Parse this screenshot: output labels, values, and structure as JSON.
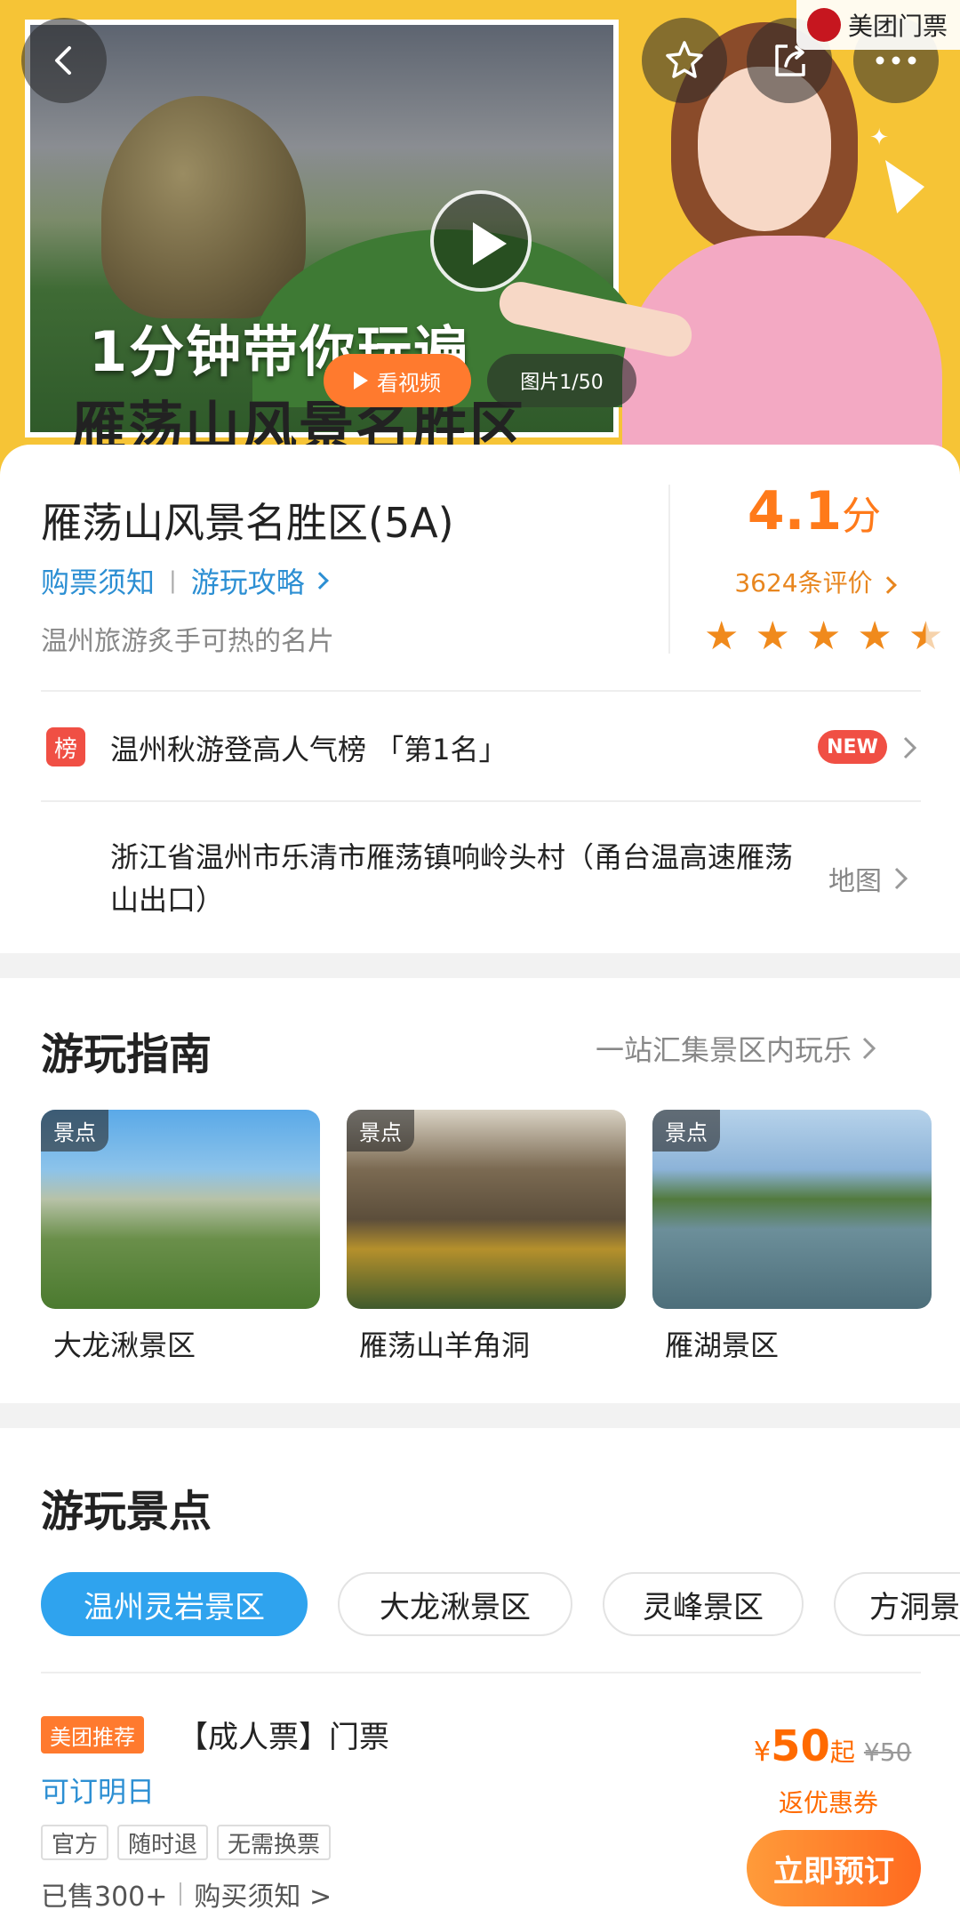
{
  "brand": {
    "name": "美团门票",
    "logo_icon": "meituan-logo-icon"
  },
  "hero": {
    "text_line1": "1分钟带你玩遍",
    "text_line2": "雁荡山风景名胜区",
    "video_label": "看视频",
    "photo_count": "图片1/50"
  },
  "scenic": {
    "title": "雁荡山风景名胜区(5A)",
    "link_notice": "购票须知",
    "link_guide": "游玩攻略",
    "slogan": "温州旅游炙手可热的名片",
    "score": "4.1",
    "score_unit": "分",
    "reviews": "3624条评价",
    "stars": 4.5,
    "rank_icon_text": "榜",
    "rank_text": "温州秋游登高人气榜 「第1名」",
    "new_badge": "NEW",
    "address": "浙江省温州市乐清市雁荡镇响岭头村（甬台温高速雁荡山出口）",
    "map_label": "地图"
  },
  "guide": {
    "title": "游玩指南",
    "more": "一站汇集景区内玩乐",
    "items": [
      {
        "tag": "景点",
        "name": "大龙湫景区"
      },
      {
        "tag": "景点",
        "name": "雁荡山羊角洞"
      },
      {
        "tag": "景点",
        "name": "雁湖景区"
      }
    ]
  },
  "spots": {
    "title": "游玩景点",
    "chips": [
      "温州灵岩景区",
      "大龙湫景区",
      "灵峰景区",
      "方洞景"
    ],
    "active_chip": 0
  },
  "ticket": {
    "badge": "美团推荐",
    "name": "【成人票】门票",
    "bookable": "可订明日",
    "tags": [
      "官方",
      "随时退",
      "无需换票"
    ],
    "sold": "已售300+",
    "notice": "购买须知 >",
    "currency": "¥",
    "price": "50",
    "price_suffix": "起",
    "orig_price": "¥50",
    "coupon": "返优惠券",
    "book_label": "立即预订"
  },
  "colors": {
    "accent_orange": "#ff7a2e",
    "link_blue": "#2c8fd3",
    "hero_yellow": "#f6c436"
  }
}
